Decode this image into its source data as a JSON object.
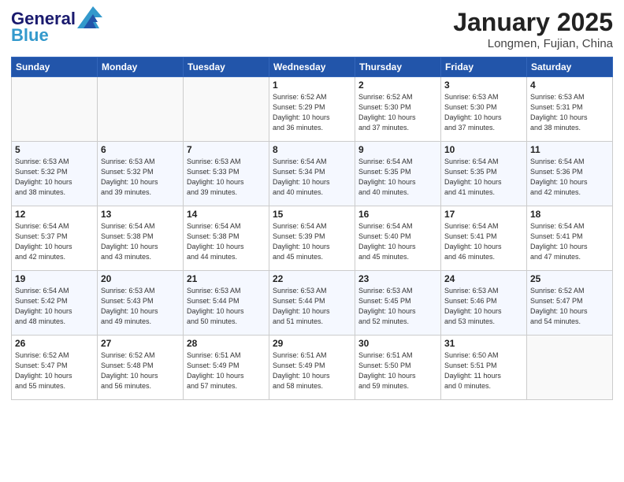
{
  "header": {
    "logo_line1": "General",
    "logo_line2": "Blue",
    "month": "January 2025",
    "location": "Longmen, Fujian, China"
  },
  "days_of_week": [
    "Sunday",
    "Monday",
    "Tuesday",
    "Wednesday",
    "Thursday",
    "Friday",
    "Saturday"
  ],
  "weeks": [
    [
      {
        "day": "",
        "info": ""
      },
      {
        "day": "",
        "info": ""
      },
      {
        "day": "",
        "info": ""
      },
      {
        "day": "1",
        "info": "Sunrise: 6:52 AM\nSunset: 5:29 PM\nDaylight: 10 hours\nand 36 minutes."
      },
      {
        "day": "2",
        "info": "Sunrise: 6:52 AM\nSunset: 5:30 PM\nDaylight: 10 hours\nand 37 minutes."
      },
      {
        "day": "3",
        "info": "Sunrise: 6:53 AM\nSunset: 5:30 PM\nDaylight: 10 hours\nand 37 minutes."
      },
      {
        "day": "4",
        "info": "Sunrise: 6:53 AM\nSunset: 5:31 PM\nDaylight: 10 hours\nand 38 minutes."
      }
    ],
    [
      {
        "day": "5",
        "info": "Sunrise: 6:53 AM\nSunset: 5:32 PM\nDaylight: 10 hours\nand 38 minutes."
      },
      {
        "day": "6",
        "info": "Sunrise: 6:53 AM\nSunset: 5:32 PM\nDaylight: 10 hours\nand 39 minutes."
      },
      {
        "day": "7",
        "info": "Sunrise: 6:53 AM\nSunset: 5:33 PM\nDaylight: 10 hours\nand 39 minutes."
      },
      {
        "day": "8",
        "info": "Sunrise: 6:54 AM\nSunset: 5:34 PM\nDaylight: 10 hours\nand 40 minutes."
      },
      {
        "day": "9",
        "info": "Sunrise: 6:54 AM\nSunset: 5:35 PM\nDaylight: 10 hours\nand 40 minutes."
      },
      {
        "day": "10",
        "info": "Sunrise: 6:54 AM\nSunset: 5:35 PM\nDaylight: 10 hours\nand 41 minutes."
      },
      {
        "day": "11",
        "info": "Sunrise: 6:54 AM\nSunset: 5:36 PM\nDaylight: 10 hours\nand 42 minutes."
      }
    ],
    [
      {
        "day": "12",
        "info": "Sunrise: 6:54 AM\nSunset: 5:37 PM\nDaylight: 10 hours\nand 42 minutes."
      },
      {
        "day": "13",
        "info": "Sunrise: 6:54 AM\nSunset: 5:38 PM\nDaylight: 10 hours\nand 43 minutes."
      },
      {
        "day": "14",
        "info": "Sunrise: 6:54 AM\nSunset: 5:38 PM\nDaylight: 10 hours\nand 44 minutes."
      },
      {
        "day": "15",
        "info": "Sunrise: 6:54 AM\nSunset: 5:39 PM\nDaylight: 10 hours\nand 45 minutes."
      },
      {
        "day": "16",
        "info": "Sunrise: 6:54 AM\nSunset: 5:40 PM\nDaylight: 10 hours\nand 45 minutes."
      },
      {
        "day": "17",
        "info": "Sunrise: 6:54 AM\nSunset: 5:41 PM\nDaylight: 10 hours\nand 46 minutes."
      },
      {
        "day": "18",
        "info": "Sunrise: 6:54 AM\nSunset: 5:41 PM\nDaylight: 10 hours\nand 47 minutes."
      }
    ],
    [
      {
        "day": "19",
        "info": "Sunrise: 6:54 AM\nSunset: 5:42 PM\nDaylight: 10 hours\nand 48 minutes."
      },
      {
        "day": "20",
        "info": "Sunrise: 6:53 AM\nSunset: 5:43 PM\nDaylight: 10 hours\nand 49 minutes."
      },
      {
        "day": "21",
        "info": "Sunrise: 6:53 AM\nSunset: 5:44 PM\nDaylight: 10 hours\nand 50 minutes."
      },
      {
        "day": "22",
        "info": "Sunrise: 6:53 AM\nSunset: 5:44 PM\nDaylight: 10 hours\nand 51 minutes."
      },
      {
        "day": "23",
        "info": "Sunrise: 6:53 AM\nSunset: 5:45 PM\nDaylight: 10 hours\nand 52 minutes."
      },
      {
        "day": "24",
        "info": "Sunrise: 6:53 AM\nSunset: 5:46 PM\nDaylight: 10 hours\nand 53 minutes."
      },
      {
        "day": "25",
        "info": "Sunrise: 6:52 AM\nSunset: 5:47 PM\nDaylight: 10 hours\nand 54 minutes."
      }
    ],
    [
      {
        "day": "26",
        "info": "Sunrise: 6:52 AM\nSunset: 5:47 PM\nDaylight: 10 hours\nand 55 minutes."
      },
      {
        "day": "27",
        "info": "Sunrise: 6:52 AM\nSunset: 5:48 PM\nDaylight: 10 hours\nand 56 minutes."
      },
      {
        "day": "28",
        "info": "Sunrise: 6:51 AM\nSunset: 5:49 PM\nDaylight: 10 hours\nand 57 minutes."
      },
      {
        "day": "29",
        "info": "Sunrise: 6:51 AM\nSunset: 5:49 PM\nDaylight: 10 hours\nand 58 minutes."
      },
      {
        "day": "30",
        "info": "Sunrise: 6:51 AM\nSunset: 5:50 PM\nDaylight: 10 hours\nand 59 minutes."
      },
      {
        "day": "31",
        "info": "Sunrise: 6:50 AM\nSunset: 5:51 PM\nDaylight: 11 hours\nand 0 minutes."
      },
      {
        "day": "",
        "info": ""
      }
    ]
  ]
}
